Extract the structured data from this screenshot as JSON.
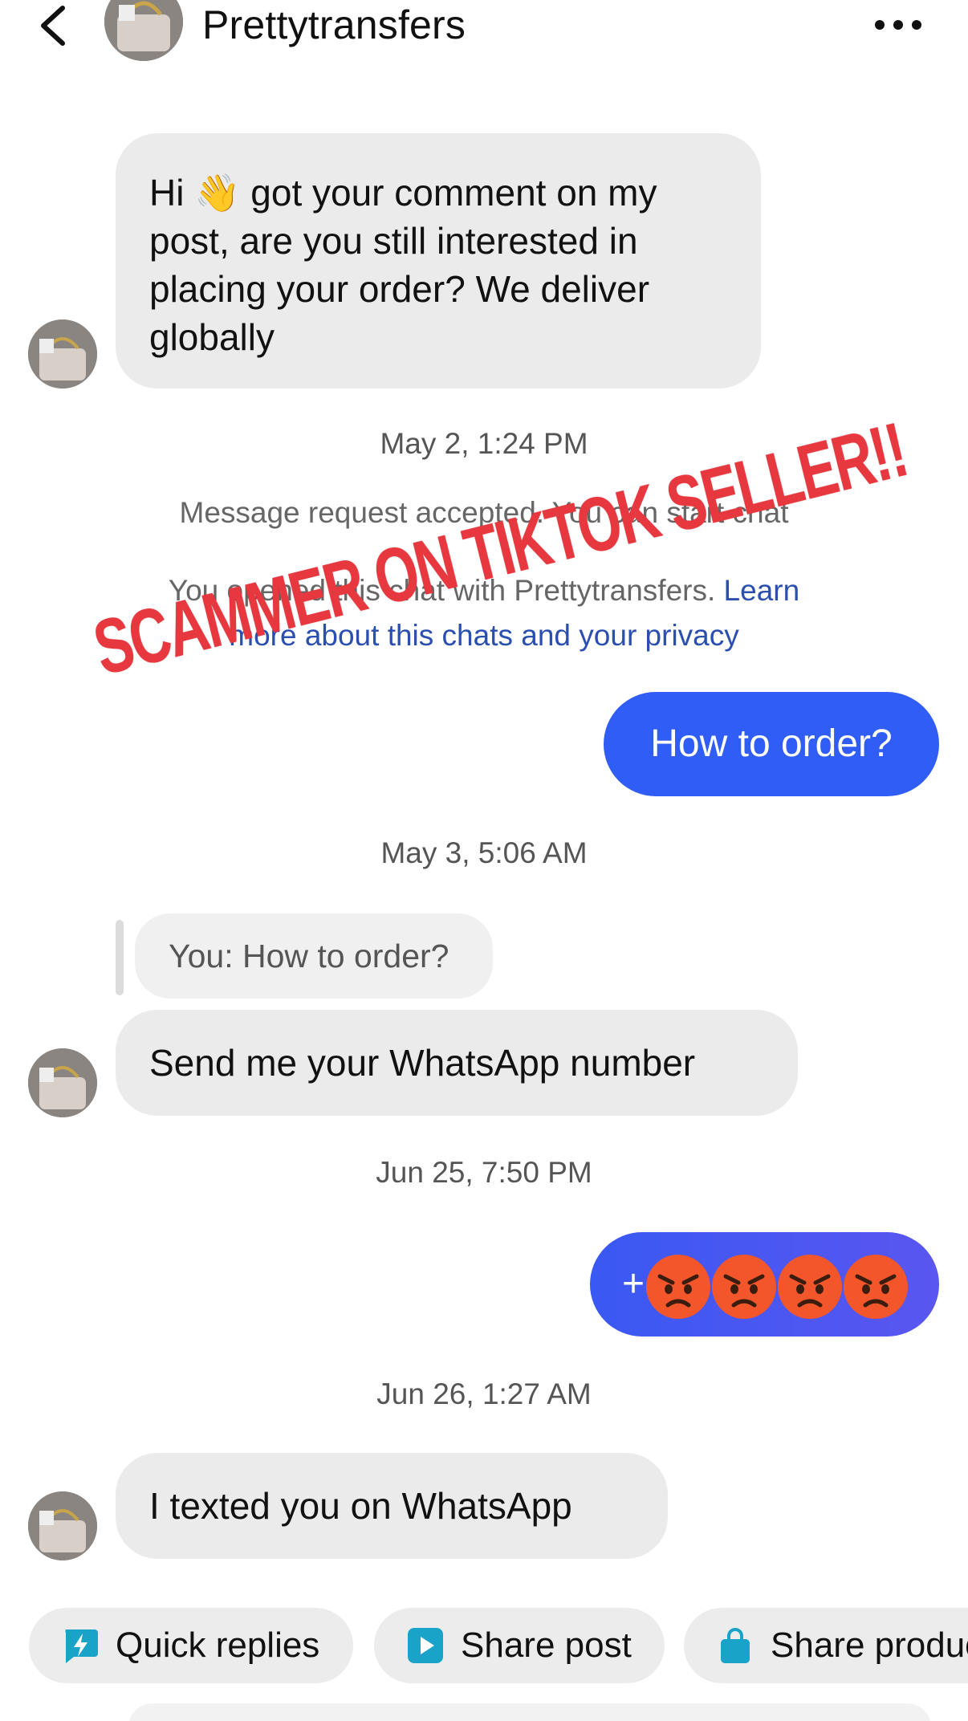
{
  "header": {
    "title": "Prettytransfers",
    "back_icon": "chevron-left-icon",
    "more_icon": "more-dots-icon"
  },
  "messages": {
    "m1": "Hi 👋 got your comment on my post, are you still interested in placing your order? We deliver globally",
    "t1": "May 2, 1:24 PM",
    "sys1": "Message request accepted. You can start chat",
    "sys2_text": "You opened this chat with Prettytransfers.",
    "sys2_link_a": "Learn",
    "sys2_link_b": "more about this chats and your privacy",
    "m2": "How to order?",
    "t2": "May 3, 5:06 AM",
    "reply_quote": "You: How to order?",
    "m3": "Send me your WhatsApp number",
    "t3": "Jun 25, 7:50 PM",
    "m4_prefix": "+",
    "t4": "Jun 26, 1:27 AM",
    "m5": "I texted you on WhatsApp"
  },
  "overlay": {
    "stamp": "SCAMMER ON TIKTOK SELLER!!"
  },
  "quick_actions": {
    "quick_replies": "Quick replies",
    "share_post": "Share post",
    "share_product": "Share product"
  },
  "colors": {
    "outgoing_bubble": "#2f5df5",
    "incoming_bubble": "#ebebeb",
    "stamp": "#e8383f",
    "link": "#2b4fae",
    "icon_teal": "#1aa3c8"
  }
}
